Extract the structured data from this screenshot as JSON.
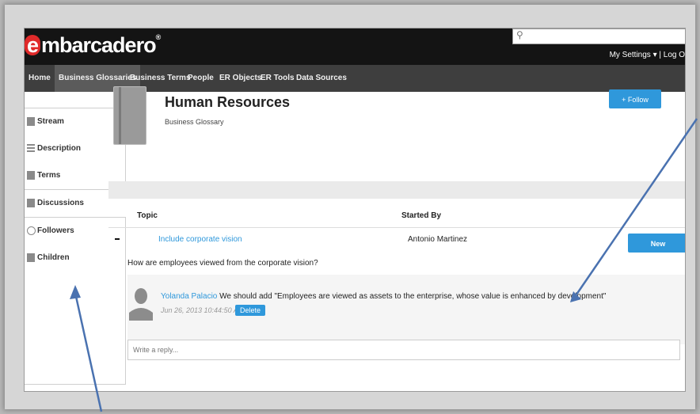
{
  "header": {
    "logo_letter": "e",
    "logo_rest": "mbarcadero",
    "logo_mark": "®",
    "search_placeholder": "",
    "settings_label": "My Settings ▾ | Log O"
  },
  "nav": {
    "items": [
      {
        "label": "Home"
      },
      {
        "label": "Business Glossaries"
      },
      {
        "label": "Business Terms"
      },
      {
        "label": "People"
      },
      {
        "label": "ER Objects"
      },
      {
        "label": "ER Tools"
      },
      {
        "label": "Data Sources"
      }
    ],
    "active_index": 1
  },
  "sidebar": {
    "items": [
      {
        "label": "Stream",
        "icon": "stream-icon"
      },
      {
        "label": "Description",
        "icon": "description-icon"
      },
      {
        "label": "Terms",
        "icon": "terms-icon"
      },
      {
        "label": "Discussions",
        "icon": "discussions-icon"
      },
      {
        "label": "Followers",
        "icon": "followers-icon"
      },
      {
        "label": "Children",
        "icon": "children-icon"
      }
    ]
  },
  "glossary": {
    "title": "Human Resources",
    "subtitle": "Business Glossary",
    "follow_label": "+ Follow"
  },
  "discussions": {
    "col_topic": "Topic",
    "col_started_by": "Started By",
    "new_discussion_label": "New Discussion",
    "rows": [
      {
        "topic": "Include corporate vision",
        "started_by": "Antonio Martinez",
        "question": "How are employees viewed from the corporate vision?",
        "reply": {
          "author": "Yolanda Palacio",
          "text": "We should add \"Employees are viewed as assets to the enterprise, whose value is enhanced by development\"",
          "timestamp": "Jun 26, 2013 10:44:50 AM",
          "delete_label": "Delete"
        }
      }
    ],
    "write_reply_placeholder": "Write a reply..."
  },
  "colors": {
    "accent": "#2f98db",
    "topbar": "#141414",
    "navbar": "#3e3e3e",
    "arrow": "#4a72b0"
  }
}
